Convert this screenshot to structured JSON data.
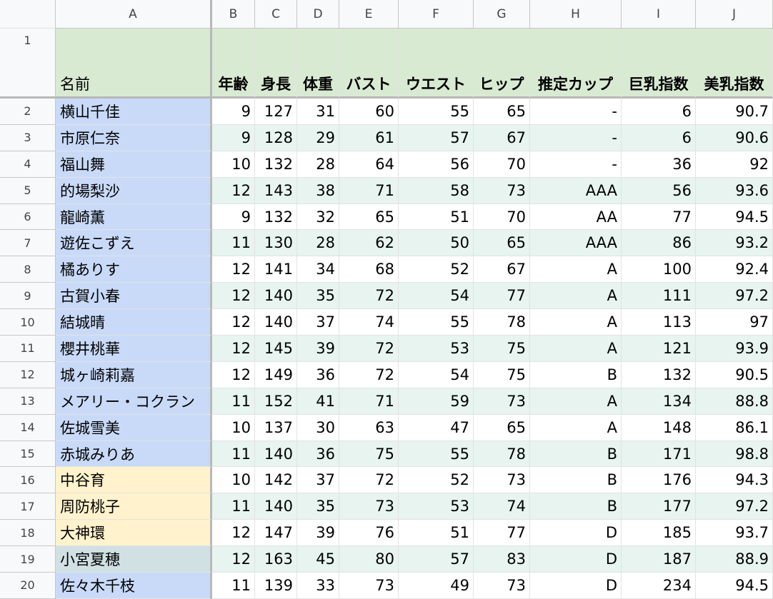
{
  "sheet": {
    "columns": [
      "A",
      "B",
      "C",
      "D",
      "E",
      "F",
      "G",
      "H",
      "I",
      "J"
    ],
    "header": {
      "row_label": "1",
      "labels": [
        "名前",
        "年齢",
        "身長",
        "体重",
        "バスト",
        "ウエスト",
        "ヒップ",
        "推定カップ",
        "巨乳指数",
        "美乳指数"
      ]
    },
    "colors": {
      "header_bg": "#d9ead3",
      "alt_row_bg": "#e7f4ef",
      "name_blue": "#c9daf8",
      "name_yellow": "#fff2cc",
      "name_gray": "#d0e0e3"
    },
    "rows": [
      {
        "num": "2",
        "name": "横山千佳",
        "color": "blue",
        "cells": [
          "9",
          "127",
          "31",
          "60",
          "55",
          "65",
          "-",
          "6",
          "90.7"
        ]
      },
      {
        "num": "3",
        "name": "市原仁奈",
        "color": "blue",
        "cells": [
          "9",
          "128",
          "29",
          "61",
          "57",
          "67",
          "-",
          "6",
          "90.6"
        ]
      },
      {
        "num": "4",
        "name": "福山舞",
        "color": "blue",
        "cells": [
          "10",
          "132",
          "28",
          "64",
          "56",
          "70",
          "-",
          "36",
          "92"
        ]
      },
      {
        "num": "5",
        "name": "的場梨沙",
        "color": "blue",
        "cells": [
          "12",
          "143",
          "38",
          "71",
          "58",
          "73",
          "AAA",
          "56",
          "93.6"
        ]
      },
      {
        "num": "6",
        "name": "龍崎薫",
        "color": "blue",
        "cells": [
          "9",
          "132",
          "32",
          "65",
          "51",
          "70",
          "AA",
          "77",
          "94.5"
        ]
      },
      {
        "num": "7",
        "name": "遊佐こずえ",
        "color": "blue",
        "cells": [
          "11",
          "130",
          "28",
          "62",
          "50",
          "65",
          "AAA",
          "86",
          "93.2"
        ]
      },
      {
        "num": "8",
        "name": "橘ありす",
        "color": "blue",
        "cells": [
          "12",
          "141",
          "34",
          "68",
          "52",
          "67",
          "A",
          "100",
          "92.4"
        ]
      },
      {
        "num": "9",
        "name": "古賀小春",
        "color": "blue",
        "cells": [
          "12",
          "140",
          "35",
          "72",
          "54",
          "77",
          "A",
          "111",
          "97.2"
        ]
      },
      {
        "num": "10",
        "name": "結城晴",
        "color": "blue",
        "cells": [
          "12",
          "140",
          "37",
          "74",
          "55",
          "78",
          "A",
          "113",
          "97"
        ]
      },
      {
        "num": "11",
        "name": "櫻井桃華",
        "color": "blue",
        "cells": [
          "12",
          "145",
          "39",
          "72",
          "53",
          "75",
          "A",
          "121",
          "93.9"
        ]
      },
      {
        "num": "12",
        "name": "城ヶ崎莉嘉",
        "color": "blue",
        "cells": [
          "12",
          "149",
          "36",
          "72",
          "54",
          "75",
          "B",
          "132",
          "90.5"
        ]
      },
      {
        "num": "13",
        "name": "メアリー・コクラン",
        "color": "blue",
        "cells": [
          "11",
          "152",
          "41",
          "71",
          "59",
          "73",
          "A",
          "134",
          "88.8"
        ]
      },
      {
        "num": "14",
        "name": "佐城雪美",
        "color": "blue",
        "cells": [
          "10",
          "137",
          "30",
          "63",
          "47",
          "65",
          "A",
          "148",
          "86.1"
        ]
      },
      {
        "num": "15",
        "name": "赤城みりあ",
        "color": "blue",
        "cells": [
          "11",
          "140",
          "36",
          "75",
          "55",
          "78",
          "B",
          "171",
          "98.8"
        ]
      },
      {
        "num": "16",
        "name": "中谷育",
        "color": "yellow",
        "cells": [
          "10",
          "142",
          "37",
          "72",
          "52",
          "73",
          "B",
          "176",
          "94.3"
        ]
      },
      {
        "num": "17",
        "name": "周防桃子",
        "color": "yellow",
        "cells": [
          "11",
          "140",
          "35",
          "73",
          "53",
          "74",
          "B",
          "177",
          "97.2"
        ]
      },
      {
        "num": "18",
        "name": "大神環",
        "color": "yellow",
        "cells": [
          "12",
          "147",
          "39",
          "76",
          "51",
          "77",
          "D",
          "185",
          "93.7"
        ]
      },
      {
        "num": "19",
        "name": "小宮夏穂",
        "color": "gray",
        "cells": [
          "12",
          "163",
          "45",
          "80",
          "57",
          "83",
          "D",
          "187",
          "88.9"
        ]
      },
      {
        "num": "20",
        "name": "佐々木千枝",
        "color": "blue",
        "cells": [
          "11",
          "139",
          "33",
          "73",
          "49",
          "73",
          "D",
          "234",
          "94.5"
        ]
      }
    ]
  }
}
